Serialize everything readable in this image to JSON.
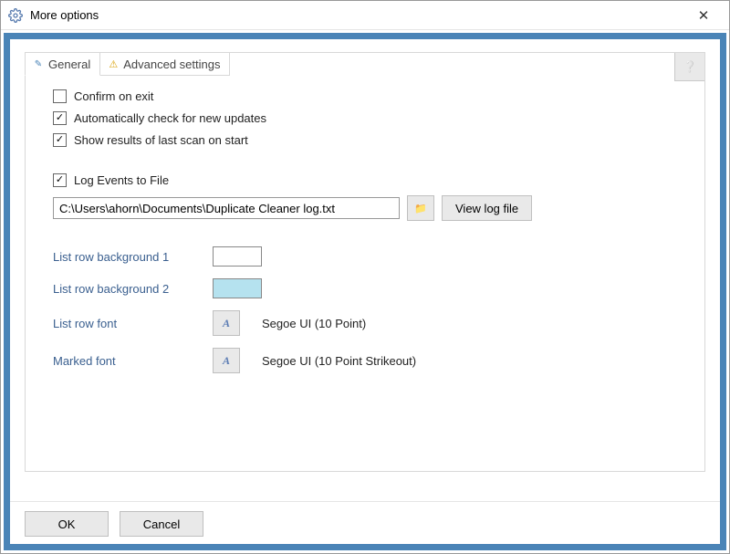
{
  "window": {
    "title": "More options"
  },
  "tabs": {
    "general": "General",
    "advanced": "Advanced settings"
  },
  "checkboxes": {
    "confirm_exit": "Confirm on exit",
    "auto_update": "Automatically check for new updates",
    "show_results": "Show results of last scan on start",
    "log_events": "Log Events to File"
  },
  "log": {
    "path": "C:\\Users\\ahorn\\Documents\\Duplicate Cleaner log.txt",
    "view_button": "View log file"
  },
  "appearance": {
    "row_bg1_label": "List row background 1",
    "row_bg1_color": "#ffffff",
    "row_bg2_label": "List row background 2",
    "row_bg2_color": "#b5e2ef",
    "row_font_label": "List row font",
    "row_font_desc": "Segoe UI (10 Point)",
    "marked_font_label": "Marked font",
    "marked_font_desc": "Segoe UI (10 Point Strikeout)"
  },
  "buttons": {
    "ok": "OK",
    "cancel": "Cancel"
  }
}
